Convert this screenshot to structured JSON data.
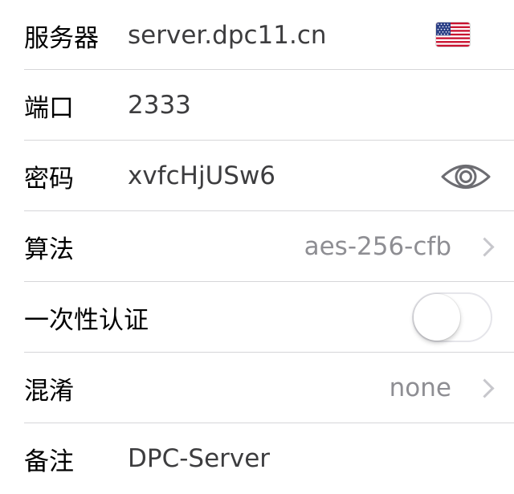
{
  "settings": {
    "server": {
      "label": "服务器",
      "value": "server.dpc11.cn",
      "flag_icon": "us-flag-icon"
    },
    "port": {
      "label": "端口",
      "value": "2333"
    },
    "password": {
      "label": "密码",
      "value": "xvfcHjUSw6",
      "reveal_icon": "eye-icon"
    },
    "cipher": {
      "label": "算法",
      "value": "aes-256-cfb"
    },
    "one_time_auth": {
      "label": "一次性认证",
      "enabled": false
    },
    "obfuscation": {
      "label": "混淆",
      "value": "none"
    },
    "remark": {
      "label": "备注",
      "value": "DPC-Server"
    }
  },
  "colors": {
    "label_text": "#000000",
    "value_text": "#3d3d3f",
    "detail_text": "#8e8e93",
    "separator": "#d6d6d9",
    "chevron": "#c7c7cc",
    "toggle_border": "#e5e5ea",
    "eye_stroke": "#6d6d72"
  }
}
